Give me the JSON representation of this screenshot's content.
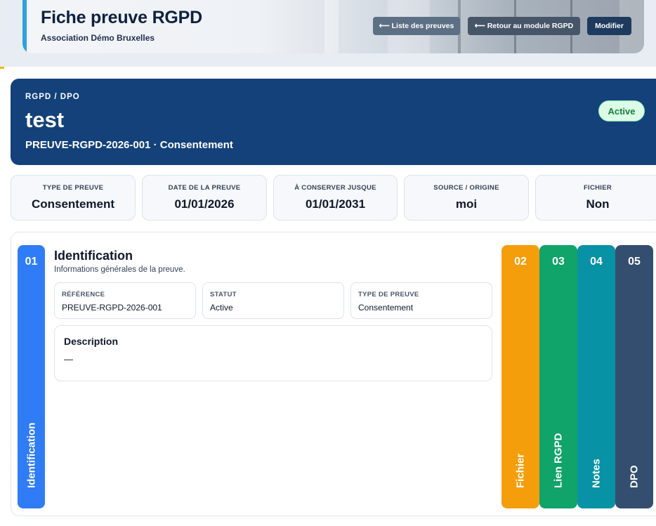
{
  "header": {
    "title": "Fiche preuve RGPD",
    "organization": "Association Démo Bruxelles",
    "buttons": {
      "list": "⟵ Liste des preuves",
      "back": "⟵ Retour au module RGPD",
      "edit": "Modifier"
    }
  },
  "hero": {
    "kicker": "RGPD / DPO",
    "title": "test",
    "subtitle": "PREUVE-RGPD-2026-001 · Consentement",
    "status": "Active"
  },
  "stats": [
    {
      "label": "TYPE DE PREUVE",
      "value": "Consentement"
    },
    {
      "label": "DATE DE LA PREUVE",
      "value": "01/01/2026"
    },
    {
      "label": "À CONSERVER JUSQUE",
      "value": "01/01/2031"
    },
    {
      "label": "SOURCE / ORIGINE",
      "value": "moi"
    },
    {
      "label": "FICHIER",
      "value": "Non"
    }
  ],
  "tabs": [
    {
      "number": "01",
      "label": "Identification"
    },
    {
      "number": "02",
      "label": "Fichier"
    },
    {
      "number": "03",
      "label": "Lien RGPD"
    },
    {
      "number": "04",
      "label": "Notes"
    },
    {
      "number": "05",
      "label": "DPO"
    }
  ],
  "section": {
    "title": "Identification",
    "description": "Informations générales de la preuve.",
    "fields": [
      {
        "label": "RÉFÉRENCE",
        "value": "PREUVE-RGPD-2026-001"
      },
      {
        "label": "STATUT",
        "value": "Active"
      },
      {
        "label": "TYPE DE PREUVE",
        "value": "Consentement"
      }
    ],
    "description_box": {
      "title": "Description",
      "value": "—"
    }
  },
  "colors": {
    "hero_bg": "#14417a",
    "tab_identification": "#2f7cf6",
    "tab_fichier": "#f59e0b",
    "tab_lien_rgpd": "#10a36a",
    "tab_notes": "#0892a5",
    "tab_dpo": "#334e6e",
    "status_active": "#15803d"
  }
}
